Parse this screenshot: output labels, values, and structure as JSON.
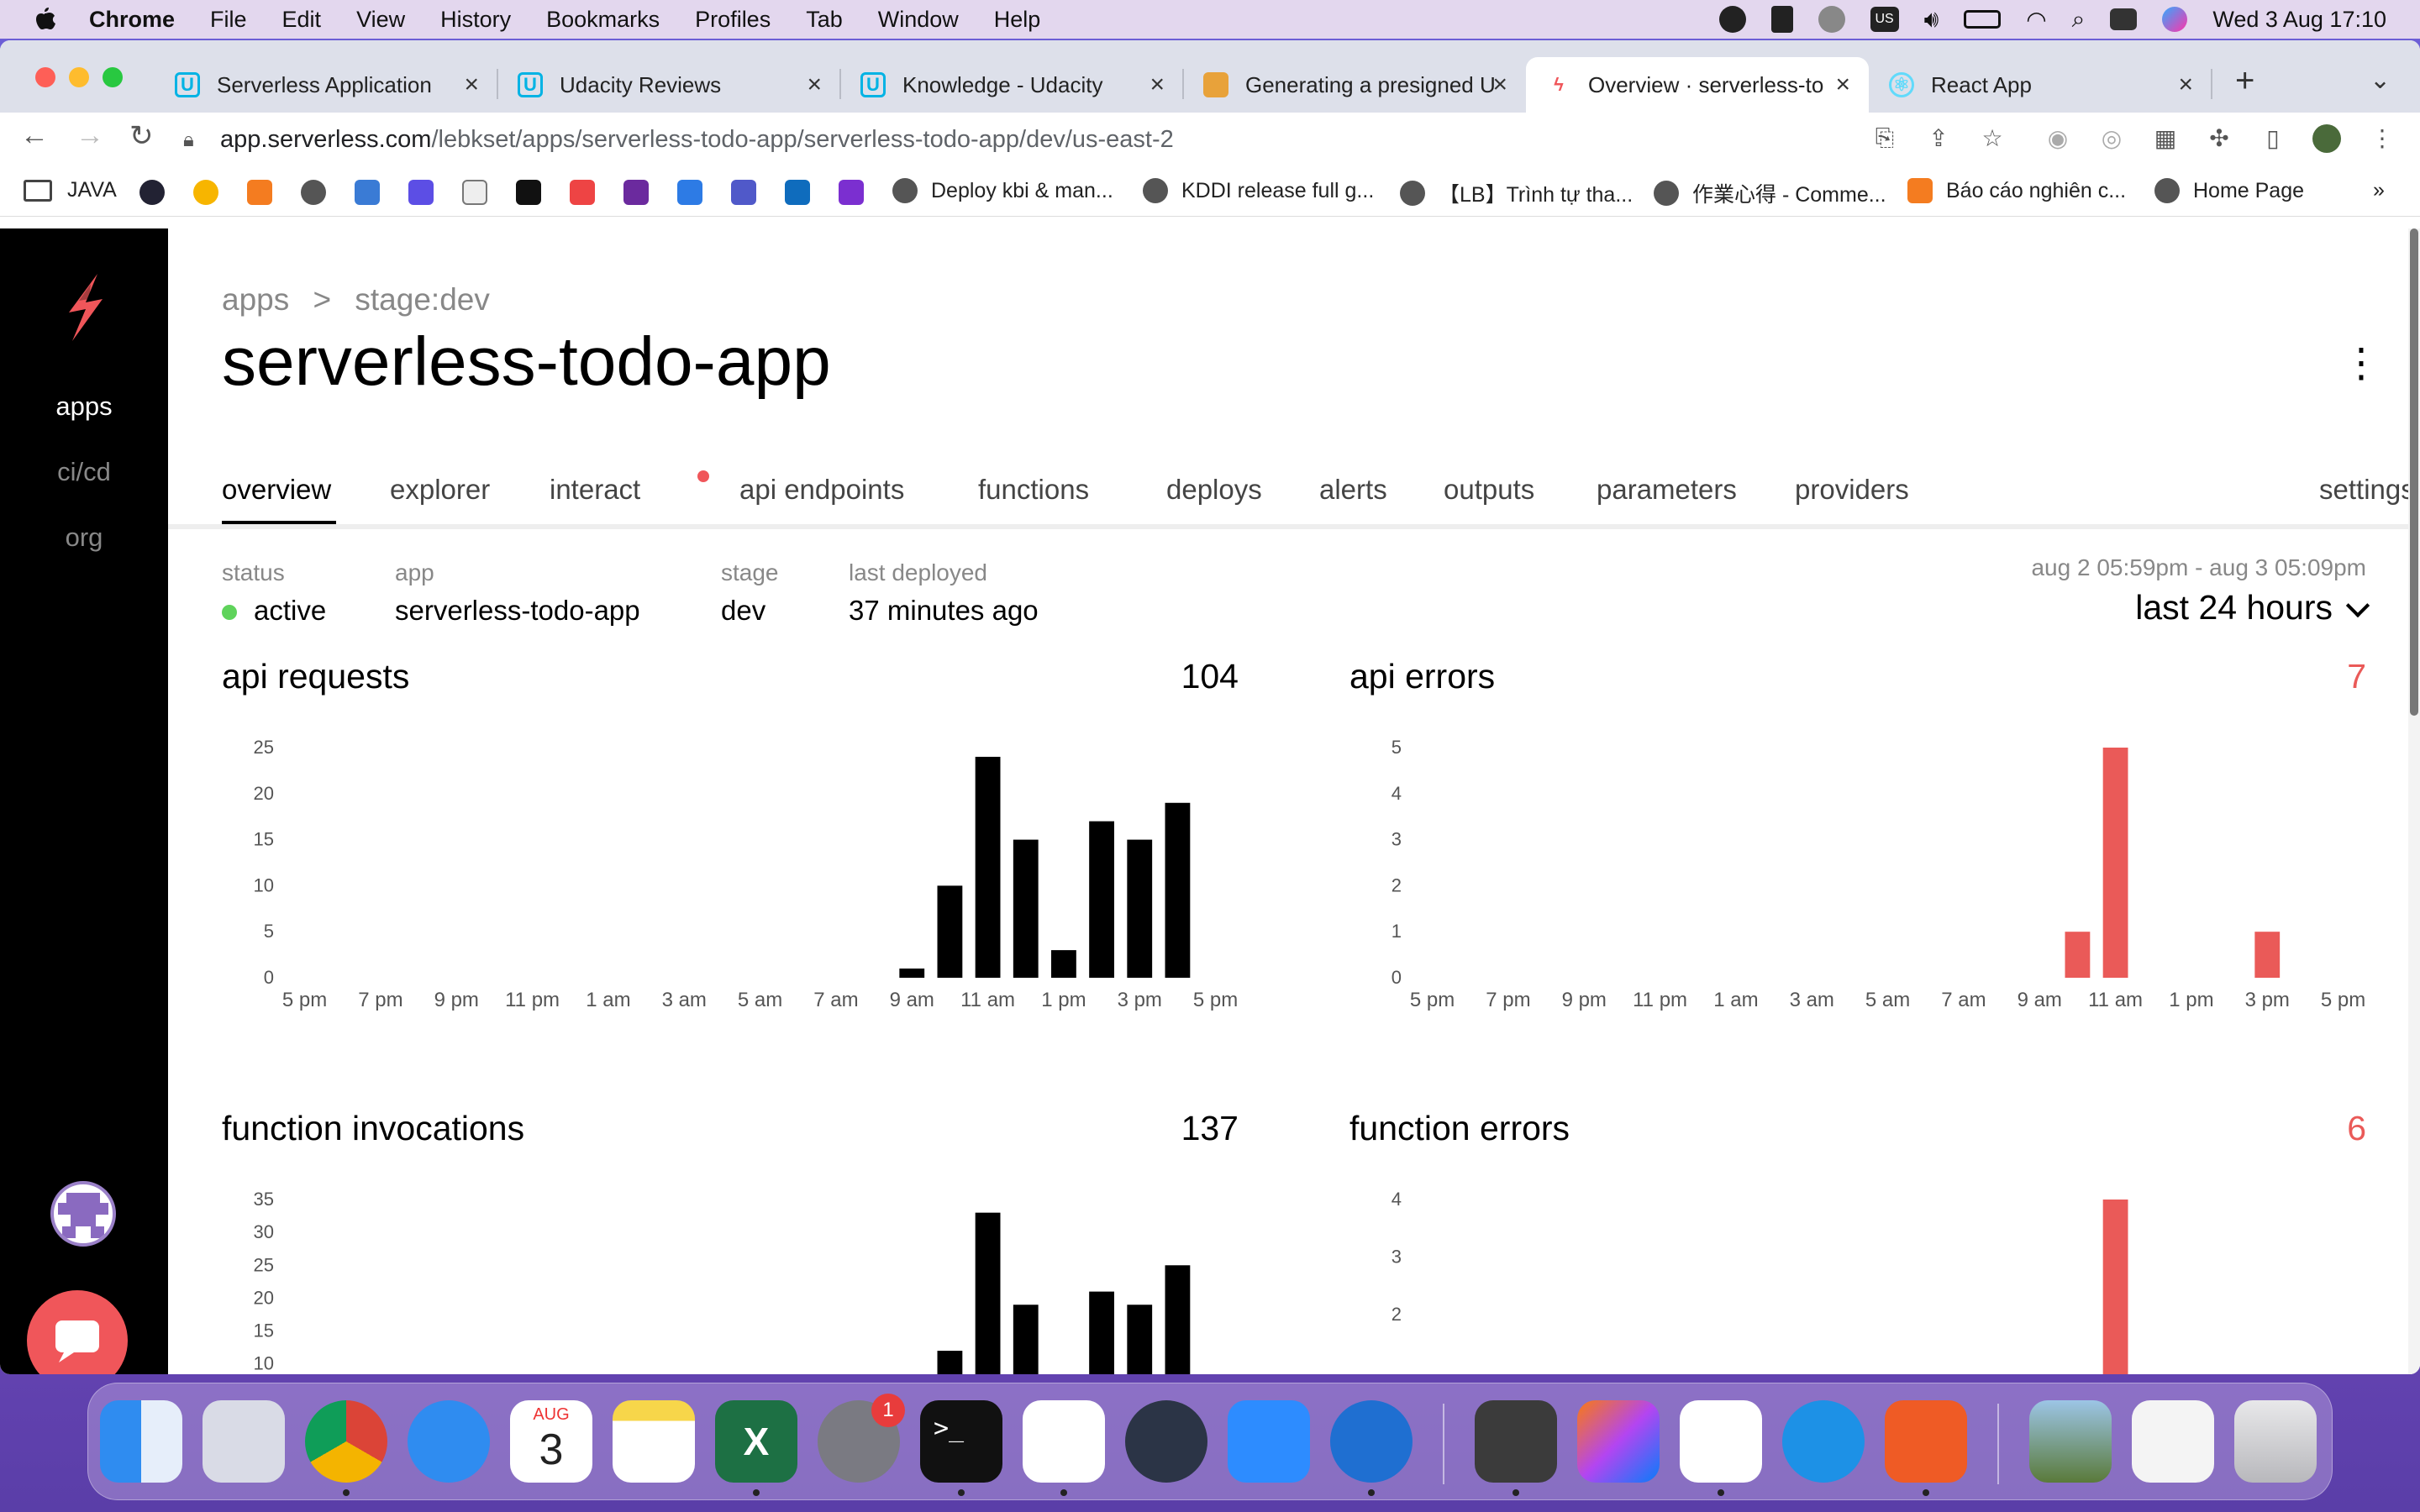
{
  "menubar": {
    "app": "Chrome",
    "items": [
      "File",
      "Edit",
      "View",
      "History",
      "Bookmarks",
      "Profiles",
      "Tab",
      "Window",
      "Help"
    ],
    "clock": "Wed 3 Aug  17:10",
    "input_source": "US"
  },
  "tabs": [
    {
      "title": "Serverless Application",
      "favicon": "udacity-icon"
    },
    {
      "title": "Udacity Reviews",
      "favicon": "udacity-icon"
    },
    {
      "title": "Knowledge - Udacity",
      "favicon": "udacity-icon"
    },
    {
      "title": "Generating a presigned U",
      "favicon": "aws-box-icon"
    },
    {
      "title": "Overview · serverless-to",
      "favicon": "serverless-icon",
      "active": true
    },
    {
      "title": "React App",
      "favicon": "react-icon"
    }
  ],
  "address": {
    "host": "app.serverless.com",
    "path": "/lebkset/apps/serverless-todo-app/serverless-todo-app/dev/us-east-2"
  },
  "bookmarks": [
    {
      "label": "JAVA",
      "icon": "folder-icon"
    },
    {
      "label": "Deploy kbi & man...",
      "icon": "globe-icon"
    },
    {
      "label": "KDDI release full g...",
      "icon": "globe-icon"
    },
    {
      "label": "【LB】Trình tự tha...",
      "icon": "globe-icon"
    },
    {
      "label": "作業心得 - Comme...",
      "icon": "globe-icon"
    },
    {
      "label": "Báo cáo nghiên c...",
      "icon": "cube-icon"
    },
    {
      "label": "Home Page",
      "icon": "globe-icon"
    }
  ],
  "sidebar": {
    "items": [
      {
        "label": "apps",
        "active": true
      },
      {
        "label": "ci/cd",
        "active": false
      },
      {
        "label": "org",
        "active": false
      }
    ]
  },
  "page": {
    "breadcrumb": {
      "root": "apps",
      "separator": ">",
      "current": "stage:dev"
    },
    "title": "serverless-todo-app",
    "tabs": [
      "overview",
      "explorer",
      "interact",
      "api endpoints",
      "functions",
      "deploys",
      "alerts",
      "outputs",
      "parameters",
      "providers"
    ],
    "settings": "settings",
    "meta": {
      "status_label": "status",
      "status_value": "active",
      "app_label": "app",
      "app_value": "serverless-todo-app",
      "stage_label": "stage",
      "stage_value": "dev",
      "deployed_label": "last deployed",
      "deployed_value": "37 minutes ago"
    },
    "range": "aug 2 05:59pm - aug 3 05:09pm",
    "period": "last 24 hours"
  },
  "colors": {
    "accent": "#f0565a",
    "error_bar": "#ea5a58",
    "active_dot": "#5fd35b",
    "bar": "#000000"
  },
  "chart_data": [
    {
      "type": "bar",
      "title": "api requests",
      "total": "104",
      "color": "#000000",
      "yticks": [
        0,
        5,
        10,
        15,
        20,
        25
      ],
      "ylim": [
        0,
        25
      ],
      "xticks": [
        "5 pm",
        "7 pm",
        "9 pm",
        "11 pm",
        "1 am",
        "3 am",
        "5 am",
        "7 am",
        "9 am",
        "11 am",
        "1 pm",
        "3 pm",
        "5 pm"
      ],
      "hours": [
        17,
        18,
        19,
        20,
        21,
        22,
        23,
        0,
        1,
        2,
        3,
        4,
        5,
        6,
        7,
        8,
        9,
        10,
        11,
        12,
        13,
        14,
        15,
        16
      ],
      "values": [
        0,
        0,
        0,
        0,
        0,
        0,
        0,
        0,
        0,
        0,
        0,
        0,
        0,
        0,
        0,
        0,
        1,
        10,
        24,
        15,
        3,
        17,
        15,
        19
      ]
    },
    {
      "type": "bar",
      "title": "api errors",
      "total": "7",
      "color": "#ea5a58",
      "yticks": [
        0,
        1,
        2,
        3,
        4,
        5
      ],
      "ylim": [
        0,
        5
      ],
      "xticks": [
        "5 pm",
        "7 pm",
        "9 pm",
        "11 pm",
        "1 am",
        "3 am",
        "5 am",
        "7 am",
        "9 am",
        "11 am",
        "1 pm",
        "3 pm",
        "5 pm"
      ],
      "hours": [
        17,
        18,
        19,
        20,
        21,
        22,
        23,
        0,
        1,
        2,
        3,
        4,
        5,
        6,
        7,
        8,
        9,
        10,
        11,
        12,
        13,
        14,
        15,
        16
      ],
      "values": [
        0,
        0,
        0,
        0,
        0,
        0,
        0,
        0,
        0,
        0,
        0,
        0,
        0,
        0,
        0,
        0,
        0,
        1,
        5,
        0,
        0,
        0,
        1,
        0
      ]
    },
    {
      "type": "bar",
      "title": "function invocations",
      "total": "137",
      "color": "#000000",
      "yticks": [
        10,
        15,
        20,
        25,
        30,
        35
      ],
      "ylim": [
        0,
        35
      ],
      "hours": [
        17,
        18,
        19,
        20,
        21,
        22,
        23,
        0,
        1,
        2,
        3,
        4,
        5,
        6,
        7,
        8,
        9,
        10,
        11,
        12,
        13,
        14,
        15,
        16
      ],
      "values": [
        0,
        0,
        0,
        0,
        0,
        0,
        0,
        0,
        0,
        0,
        0,
        0,
        0,
        0,
        0,
        0,
        0,
        12,
        33,
        19,
        0,
        21,
        19,
        25
      ]
    },
    {
      "type": "bar",
      "title": "function errors",
      "total": "6",
      "color": "#ea5a58",
      "yticks": [
        2,
        3,
        4
      ],
      "ylim": [
        0,
        4
      ],
      "hours": [
        17,
        18,
        19,
        20,
        21,
        22,
        23,
        0,
        1,
        2,
        3,
        4,
        5,
        6,
        7,
        8,
        9,
        10,
        11,
        12,
        13,
        14,
        15,
        16
      ],
      "values": [
        0,
        0,
        0,
        0,
        0,
        0,
        0,
        0,
        0,
        0,
        0,
        0,
        0,
        0,
        0,
        0,
        0,
        0,
        4,
        0,
        0,
        0,
        0,
        0
      ]
    }
  ],
  "dock": {
    "calendar_month": "AUG",
    "calendar_day": "3",
    "settings_badge": "1",
    "apps": [
      "finder-icon",
      "launchpad-icon",
      "chrome-icon",
      "safari-icon",
      "calendar-icon",
      "notes-icon",
      "excel-icon",
      "system-preferences-icon",
      "terminal-icon",
      "slack-icon",
      "quicktime-icon",
      "zoom-icon",
      "sourcetree-icon",
      "sublime-icon",
      "intellij-icon",
      "vscode-icon",
      "docker-icon",
      "postman-icon",
      "photos-icon",
      "preview-icon",
      "trash-icon"
    ]
  }
}
